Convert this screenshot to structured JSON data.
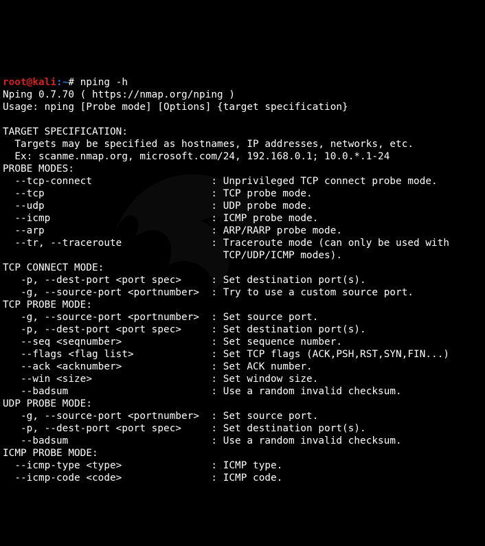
{
  "prompt": {
    "user": "root",
    "at": "@",
    "host": "kali",
    "colon": ":",
    "path": "~",
    "symbol": "# ",
    "command": "nping -h"
  },
  "out": {
    "l1": "Nping 0.7.70 ( https://nmap.org/nping )",
    "l2": "Usage: nping [Probe mode] [Options] {target specification}",
    "l3": "",
    "l4": "TARGET SPECIFICATION:",
    "l5": "  Targets may be specified as hostnames, IP addresses, networks, etc.",
    "l6": "  Ex: scanme.nmap.org, microsoft.com/24, 192.168.0.1; 10.0.*.1-24",
    "l7": "PROBE MODES:",
    "l8": "  --tcp-connect                    : Unprivileged TCP connect probe mode.",
    "l9": "  --tcp                            : TCP probe mode.",
    "l10": "  --udp                            : UDP probe mode.",
    "l11": "  --icmp                           : ICMP probe mode.",
    "l12": "  --arp                            : ARP/RARP probe mode.",
    "l13": "  --tr, --traceroute               : Traceroute mode (can only be used with ",
    "l14": "                                     TCP/UDP/ICMP modes).",
    "l15": "TCP CONNECT MODE:",
    "l16": "   -p, --dest-port <port spec>     : Set destination port(s).",
    "l17": "   -g, --source-port <portnumber>  : Try to use a custom source port.",
    "l18": "TCP PROBE MODE:",
    "l19": "   -g, --source-port <portnumber>  : Set source port.",
    "l20": "   -p, --dest-port <port spec>     : Set destination port(s).",
    "l21": "   --seq <seqnumber>               : Set sequence number.",
    "l22": "   --flags <flag list>             : Set TCP flags (ACK,PSH,RST,SYN,FIN...)",
    "l23": "   --ack <acknumber>               : Set ACK number.",
    "l24": "   --win <size>                    : Set window size.",
    "l25": "   --badsum                        : Use a random invalid checksum.",
    "l26": "UDP PROBE MODE:",
    "l27": "   -g, --source-port <portnumber>  : Set source port.",
    "l28": "   -p, --dest-port <port spec>     : Set destination port(s).",
    "l29": "   --badsum                        : Use a random invalid checksum.",
    "l30": "ICMP PROBE MODE:",
    "l31": "  --icmp-type <type>               : ICMP type.",
    "l32": "  --icmp-code <code>               : ICMP code."
  }
}
